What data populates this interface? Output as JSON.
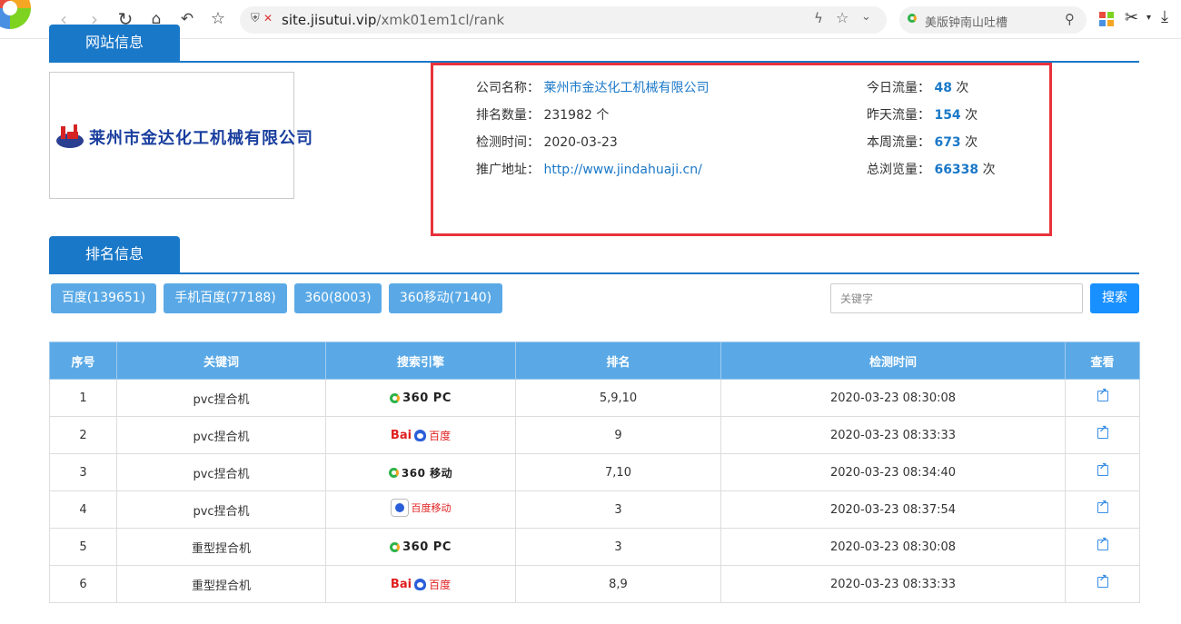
{
  "browser": {
    "url_host": "site.jisutui.vip",
    "url_path": "/xmk01em1cl/rank",
    "search_text": "美版钟南山吐槽"
  },
  "site_section": {
    "title": "网站信息"
  },
  "company": {
    "logo_text": "莱州市金达化工机械有限公司",
    "name_label": "公司名称：",
    "name_value": "莱州市金达化工机械有限公司",
    "rank_count_label": "排名数量：",
    "rank_count_value": "231982 个",
    "check_time_label": "检测时间：",
    "check_time_value": "2020-03-23",
    "promo_url_label": "推广地址：",
    "promo_url_value": "http://www.jindahuaji.cn/",
    "today_label": "今日流量：",
    "today_value": "48",
    "yesterday_label": "昨天流量：",
    "yesterday_value": "154",
    "week_label": "本周流量：",
    "week_value": "673",
    "total_label": "总浏览量：",
    "total_value": "66338",
    "unit": "次"
  },
  "rank_section": {
    "title": "排名信息"
  },
  "engine_filters": [
    "百度(139651)",
    "手机百度(77188)",
    "360(8003)",
    "360移动(7140)"
  ],
  "search": {
    "placeholder": "关键字",
    "button": "搜索"
  },
  "table": {
    "headers": [
      "序号",
      "关键词",
      "搜索引擎",
      "排名",
      "检测时间",
      "查看"
    ],
    "rows": [
      {
        "no": "1",
        "keyword": "pvc捏合机",
        "engine": "360 PC",
        "engine_type": "360pc",
        "rank": "5,9,10",
        "time": "2020-03-23 08:30:08"
      },
      {
        "no": "2",
        "keyword": "pvc捏合机",
        "engine": "百度",
        "engine_type": "baidu",
        "rank": "9",
        "time": "2020-03-23 08:33:33"
      },
      {
        "no": "3",
        "keyword": "pvc捏合机",
        "engine": "360 移动",
        "engine_type": "360m",
        "rank": "7,10",
        "time": "2020-03-23 08:34:40"
      },
      {
        "no": "4",
        "keyword": "pvc捏合机",
        "engine": "百度移动",
        "engine_type": "baidum",
        "rank": "3",
        "time": "2020-03-23 08:37:54"
      },
      {
        "no": "5",
        "keyword": "重型捏合机",
        "engine": "360 PC",
        "engine_type": "360pc",
        "rank": "3",
        "time": "2020-03-23 08:30:08"
      },
      {
        "no": "6",
        "keyword": "重型捏合机",
        "engine": "百度",
        "engine_type": "baidu",
        "rank": "8,9",
        "time": "2020-03-23 08:33:33"
      }
    ]
  }
}
